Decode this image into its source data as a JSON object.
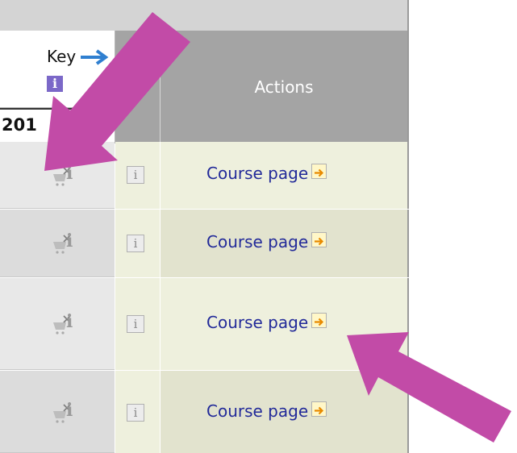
{
  "key": {
    "label": "Key",
    "arrow_icon": "right-arrow-icon",
    "info_glyph": "i"
  },
  "year": "201",
  "header": {
    "actions": "Actions"
  },
  "rows": [
    {
      "info_glyph": "i",
      "box_glyph": "i",
      "link": "Course page",
      "unavailable_icon": "cart-unavailable-icon",
      "external_icon": "external-link-icon"
    },
    {
      "info_glyph": "i",
      "box_glyph": "i",
      "link": "Course page",
      "unavailable_icon": "cart-unavailable-icon",
      "external_icon": "external-link-icon"
    },
    {
      "info_glyph": "i",
      "box_glyph": "i",
      "link": "Course page",
      "unavailable_icon": "cart-unavailable-icon",
      "external_icon": "external-link-icon"
    },
    {
      "info_glyph": "i",
      "box_glyph": "i",
      "link": "Course page",
      "unavailable_icon": "cart-unavailable-icon",
      "external_icon": "external-link-icon"
    }
  ],
  "colors": {
    "header_bg": "#a4a4a4",
    "link": "#222a99",
    "annotation_arrow": "#c24ba7",
    "key_info_bg": "#7b68c8"
  }
}
